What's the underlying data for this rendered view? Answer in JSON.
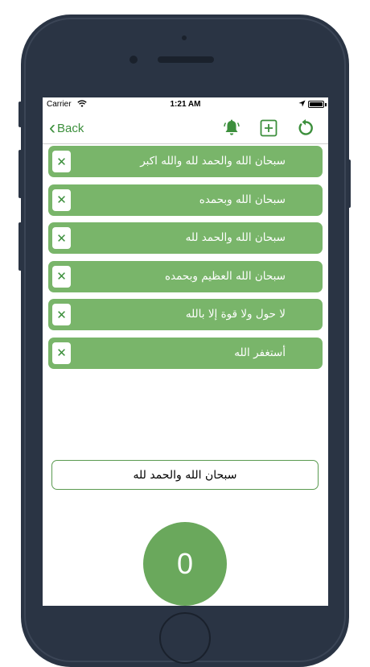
{
  "status_bar": {
    "carrier": "Carrier",
    "time": "1:21 AM"
  },
  "nav": {
    "back_label": "Back",
    "accent_color": "#3c8f3c",
    "icons": [
      "bell-icon",
      "add-square-icon",
      "refresh-icon"
    ]
  },
  "dhikr_list": [
    {
      "text": "سبحان الله والحمد لله والله اكبر"
    },
    {
      "text": "سبحان الله وبحمده"
    },
    {
      "text": "سبحان الله والحمد لله"
    },
    {
      "text": "سبحان الله العظيم وبحمده"
    },
    {
      "text": "لا حول ولا قوة إلا بالله"
    },
    {
      "text": "أستغفر الله"
    }
  ],
  "item_color": "#79b56a",
  "current_dhikr": "سبحان الله والحمد لله",
  "counter": {
    "value": "0",
    "color": "#6aa85c"
  }
}
